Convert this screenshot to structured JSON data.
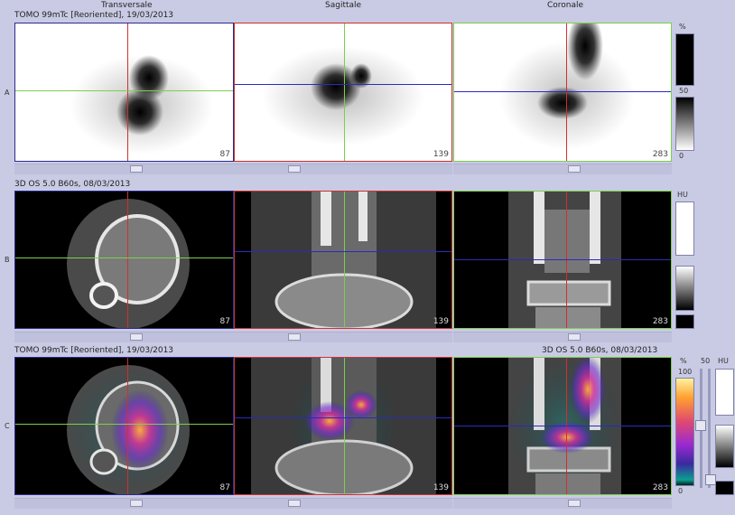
{
  "headers": {
    "transversale": "Transversale",
    "sagittale": "Sagittale",
    "coronale": "Coronale"
  },
  "rows": {
    "A": {
      "label": "A",
      "info": "TOMO 99mTc [Reoriented], 19/03/2013"
    },
    "B": {
      "label": "B",
      "info": "3D  OS  5.0  B60s, 08/03/2013"
    },
    "C": {
      "label": "C",
      "info_left": "TOMO 99mTc [Reoriented], 19/03/2013",
      "info_right": "3D  OS  5.0  B60s, 08/03/2013"
    }
  },
  "slices": {
    "transversale": "87",
    "sagittale": "139",
    "coronale": "283"
  },
  "colorbars": {
    "A": {
      "unit": "%",
      "mid": "50",
      "min": "0"
    },
    "B": {
      "unit": "HU"
    },
    "C": {
      "unit_left": "%",
      "max_left": "100",
      "min_left": "0",
      "unit_right": "HU",
      "mid_right": "50"
    }
  },
  "colors": {
    "red": "#d03030",
    "green": "#7bd04a",
    "blue": "#2a2ac0",
    "background": "#c9cbe4"
  }
}
